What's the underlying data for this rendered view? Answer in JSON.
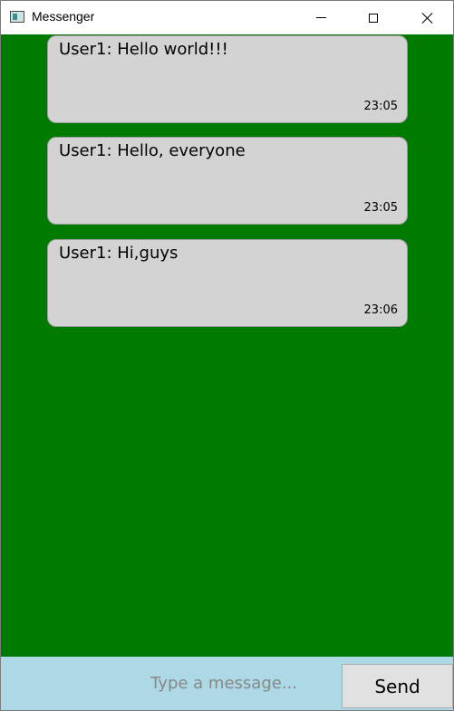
{
  "window": {
    "title": "Messenger",
    "app_icon": "app-window-icon",
    "controls": {
      "minimize_icon": "minimize-icon",
      "maximize_icon": "maximize-icon",
      "close_icon": "close-icon"
    }
  },
  "colors": {
    "chat_background": "#007a00",
    "bubble_background": "#d3d3d3",
    "input_bar_background": "#add8e6",
    "send_button_background": "#e1e1e1"
  },
  "messages": [
    {
      "text": "User1: Hello world!!!",
      "time": "23:05"
    },
    {
      "text": "User1: Hello, everyone",
      "time": "23:05"
    },
    {
      "text": "User1: Hi,guys",
      "time": "23:06"
    }
  ],
  "composer": {
    "placeholder": "Type a message...",
    "value": "",
    "send_label": "Send"
  }
}
